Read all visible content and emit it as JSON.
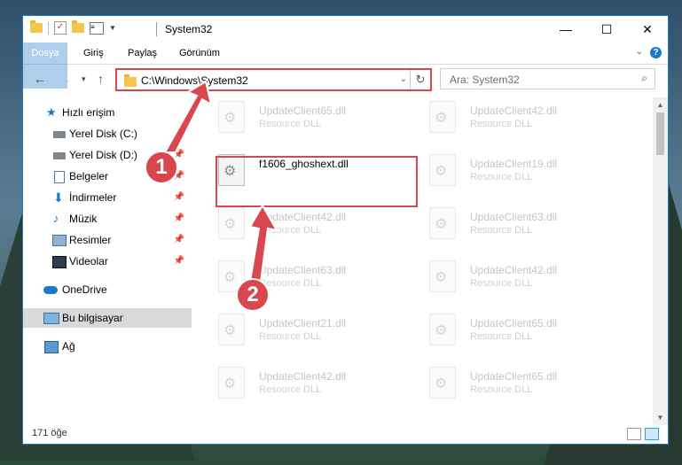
{
  "window": {
    "title": "System32",
    "controls": {
      "minimize": "—",
      "maximize": "☐",
      "close": "✕"
    }
  },
  "ribbon": {
    "tabs": [
      "Dosya",
      "Giriş",
      "Paylaş",
      "Görünüm"
    ],
    "help": "?"
  },
  "navigation": {
    "address": "C:\\Windows\\System32",
    "search_placeholder": "Ara: System32"
  },
  "sidebar": {
    "items": [
      {
        "label": "Hızlı erişim",
        "icon": "star-icon"
      },
      {
        "label": "Yerel Disk (C:)",
        "icon": "drive-icon"
      },
      {
        "label": "Yerel Disk (D:)",
        "icon": "drive-icon"
      },
      {
        "label": "Belgeler",
        "icon": "documents-icon"
      },
      {
        "label": "İndirmeler",
        "icon": "download-icon"
      },
      {
        "label": "Müzik",
        "icon": "music-icon"
      },
      {
        "label": "Resimler",
        "icon": "pictures-icon"
      },
      {
        "label": "Videolar",
        "icon": "videos-icon"
      },
      {
        "label": "OneDrive",
        "icon": "cloud-icon"
      },
      {
        "label": "Bu bilgisayar",
        "icon": "computer-icon"
      },
      {
        "label": "Ağ",
        "icon": "network-icon"
      }
    ]
  },
  "files": {
    "left": [
      {
        "name": "UpdateClient65.dll",
        "type": "Resource DLL"
      },
      {
        "name": "f1606_ghoshext.dll",
        "type": ""
      },
      {
        "name": "UpdateClient42.dll",
        "type": "Resource DLL"
      },
      {
        "name": "UpdateClient63.dll",
        "type": "Resource DLL"
      },
      {
        "name": "UpdateClient21.dll",
        "type": "Resource DLL"
      },
      {
        "name": "UpdateClient42.dll",
        "type": "Resource DLL"
      }
    ],
    "right": [
      {
        "name": "UpdateClient42.dll",
        "type": "Resource DLL"
      },
      {
        "name": "UpdateClient19.dll",
        "type": "Resource DLL"
      },
      {
        "name": "UpdateClient63.dll",
        "type": "Resource DLL"
      },
      {
        "name": "UpdateClient42.dll",
        "type": "Resource DLL"
      },
      {
        "name": "UpdateClient65.dll",
        "type": "Resource DLL"
      },
      {
        "name": "UpdateClient65.dll",
        "type": "Resource DLL"
      }
    ]
  },
  "status": {
    "count": "171 öğe"
  },
  "annotations": {
    "step1": "1",
    "step2": "2",
    "color": "#d9464e"
  }
}
